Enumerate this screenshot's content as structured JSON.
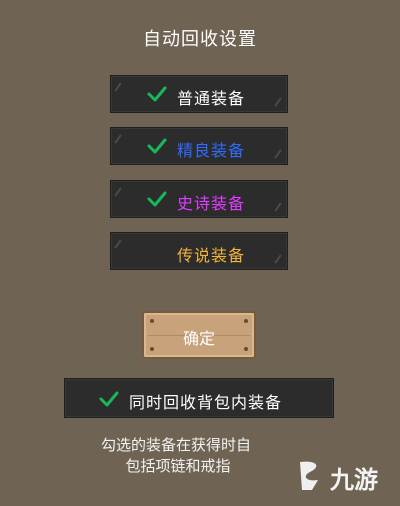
{
  "title": "自动回收设置",
  "options": [
    {
      "label": "普通装备",
      "checked": true,
      "color": "#ffffff"
    },
    {
      "label": "精良装备",
      "checked": true,
      "color": "#2f6bff"
    },
    {
      "label": "史诗装备",
      "checked": true,
      "color": "#e13cff"
    },
    {
      "label": "传说装备",
      "checked": false,
      "color": "#f2b33b"
    }
  ],
  "confirm_label": "确定",
  "bag_option": {
    "label": "同时回收背包内装备",
    "checked": true
  },
  "description": {
    "line1": "勾选的装备在获得时自",
    "line2": "包括项链和戒指"
  },
  "watermark": {
    "text": "九游"
  },
  "colors": {
    "check": "#18b85a",
    "background": "#6f6454",
    "panel": "#2c2c2c",
    "button": "#c8a27a"
  }
}
